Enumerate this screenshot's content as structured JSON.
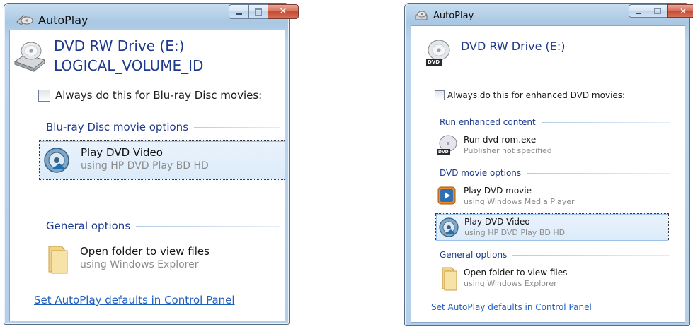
{
  "left_dialog": {
    "title": "AutoPlay",
    "drive_name": "DVD RW Drive (E:)",
    "volume_id": "LOGICAL_VOLUME_ID",
    "always_checkbox": {
      "label": "Always do this for Blu-ray Disc movies:",
      "checked": false
    },
    "section_movie": "Blu-ray Disc movie options",
    "play_item": {
      "title": "Play DVD Video",
      "subtitle": "using HP DVD Play BD HD",
      "selected": true
    },
    "section_general": "General options",
    "open_item": {
      "title": "Open folder to view files",
      "subtitle": "using Windows Explorer"
    },
    "control_panel_link": "Set AutoPlay defaults in Control Panel"
  },
  "right_dialog": {
    "title": "AutoPlay",
    "drive_name": "DVD RW Drive (E:)",
    "always_checkbox": {
      "label": "Always do this for enhanced DVD movies:",
      "checked": false
    },
    "section_enhanced": "Run enhanced content",
    "run_item": {
      "title": "Run dvd-rom.exe",
      "subtitle": "Publisher not specified",
      "icon_label": "DVD"
    },
    "section_movie": "DVD movie options",
    "wmp_item": {
      "title": "Play DVD movie",
      "subtitle": "using Windows Media Player"
    },
    "play_item": {
      "title": "Play DVD Video",
      "subtitle": "using HP DVD Play BD HD",
      "selected": true
    },
    "section_general": "General options",
    "open_item": {
      "title": "Open folder to view files",
      "subtitle": "using Windows Explorer"
    },
    "control_panel_link": "Set AutoPlay defaults in Control Panel",
    "drive_icon_label": "DVD"
  },
  "icons": {
    "title_icon": "autoplay-icon",
    "minimize": "minimize-icon",
    "maximize": "maximize-icon",
    "close": "close-icon",
    "drive": "dvd-drive-icon",
    "play": "hp-dvd-play-icon",
    "wmp": "media-player-icon",
    "folder": "folder-icon"
  },
  "colors": {
    "heading_blue": "#1e3a8a",
    "link_blue": "#1f5fbf",
    "subtitle_gray": "#8c8c8c",
    "frame_blue": "#b3cfe9",
    "close_red": "#c34a30"
  }
}
